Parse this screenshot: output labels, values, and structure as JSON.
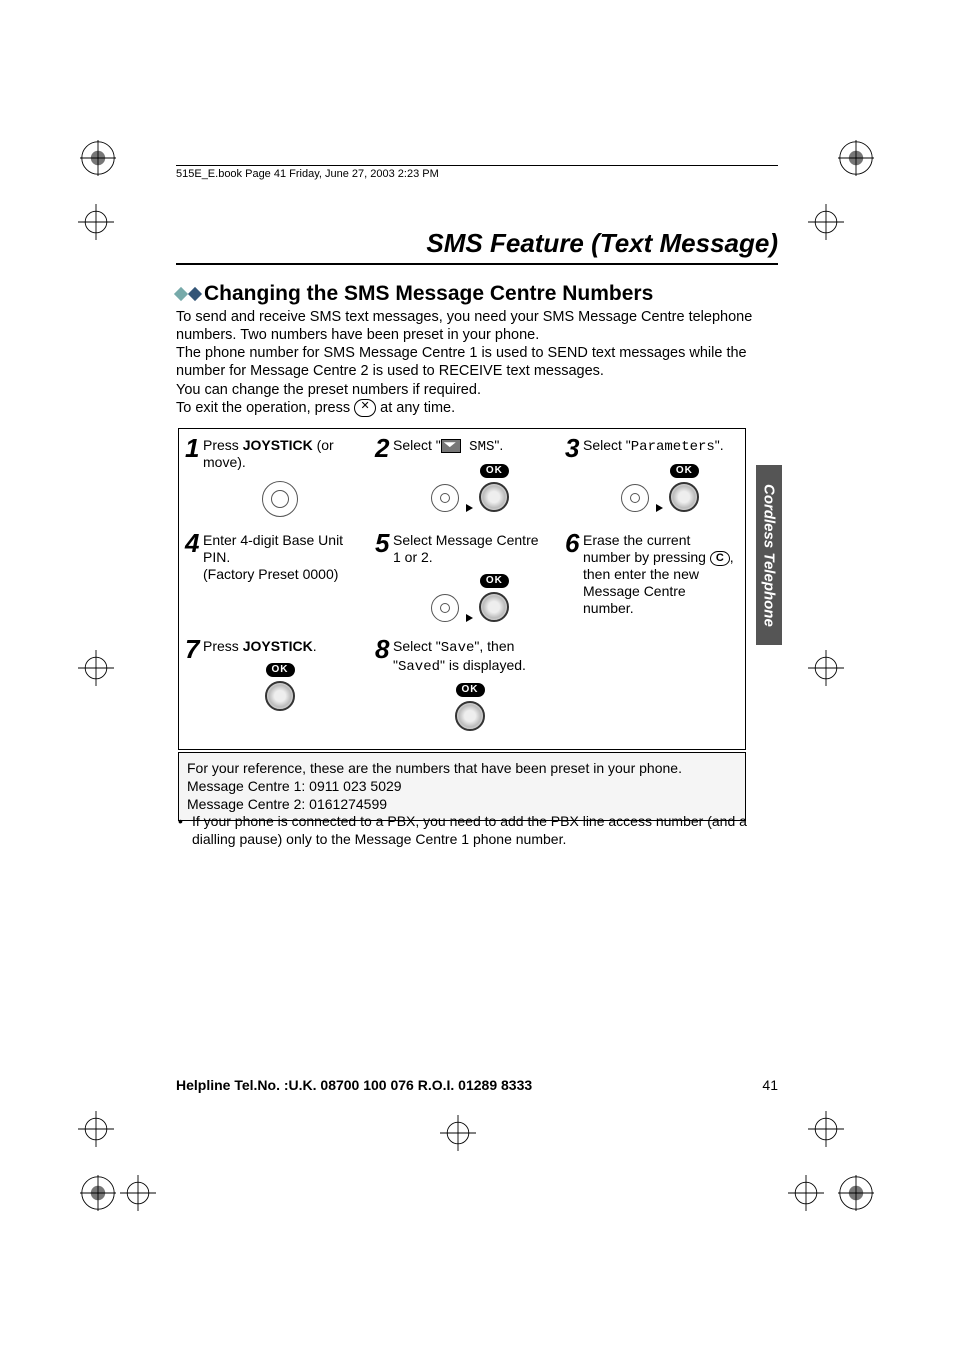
{
  "header": {
    "running_head": "515E_E.book  Page 41  Friday, June 27, 2003  2:23 PM"
  },
  "page": {
    "title": "SMS Feature (Text Message)",
    "section_heading": "Changing the SMS Message Centre Numbers",
    "intro_p1": "To send and receive SMS text messages, you need your SMS Message Centre telephone numbers. Two numbers have been preset in your phone.",
    "intro_p2": "The phone number for SMS Message Centre 1 is used to SEND text messages while the number for Message Centre 2 is used to RECEIVE text messages.",
    "intro_p3": "You can change the preset numbers if required.",
    "intro_p4_a": "To exit the operation, press ",
    "intro_p4_b": " at any time."
  },
  "steps": {
    "s1": {
      "num": "1",
      "t1": "Press ",
      "bold": "JOYSTICK",
      "t2": " (or move)."
    },
    "s2": {
      "num": "2",
      "t1": "Select \"",
      "mono": " SMS",
      "t2": "\"."
    },
    "s3": {
      "num": "3",
      "t1": "Select \"",
      "mono": "Parameters",
      "t2": "\"."
    },
    "s4": {
      "num": "4",
      "t1": "Enter 4-digit Base Unit PIN.",
      "t2": "(Factory Preset 0000)"
    },
    "s5": {
      "num": "5",
      "t1": "Select Message Centre 1 or 2."
    },
    "s6": {
      "num": "6",
      "t1": "Erase the current number by pressing ",
      "t2": ", then enter the new Message Centre number."
    },
    "s7": {
      "num": "7",
      "t1": "Press ",
      "bold": "JOYSTICK",
      "t2": "."
    },
    "s8": {
      "num": "8",
      "t1": "Select \"",
      "mono1": "Save",
      "t2": "\", then \"",
      "mono2": "Saved",
      "t3": "\" is displayed."
    }
  },
  "ok_label": "OK",
  "side_tab": "Cordless Telephone",
  "reference_box": {
    "l1": "For your reference, these are the numbers that have been preset in your phone.",
    "l2": "Message Centre 1: 0911 023 5029",
    "l3": "Message Centre 2: 0161274599"
  },
  "note": "If your phone is connected to a PBX, you need to add the PBX line access number (and a dialling pause) only to the Message Centre 1 phone number.",
  "footer": {
    "helpline": "Helpline Tel.No. :U.K. 08700 100 076  R.O.I. 01289 8333",
    "page_num": "41"
  },
  "icons": {
    "cancel": "cancel-icon",
    "envelope": "envelope-icon",
    "joystick": "joystick-icon",
    "c_button": "C"
  }
}
